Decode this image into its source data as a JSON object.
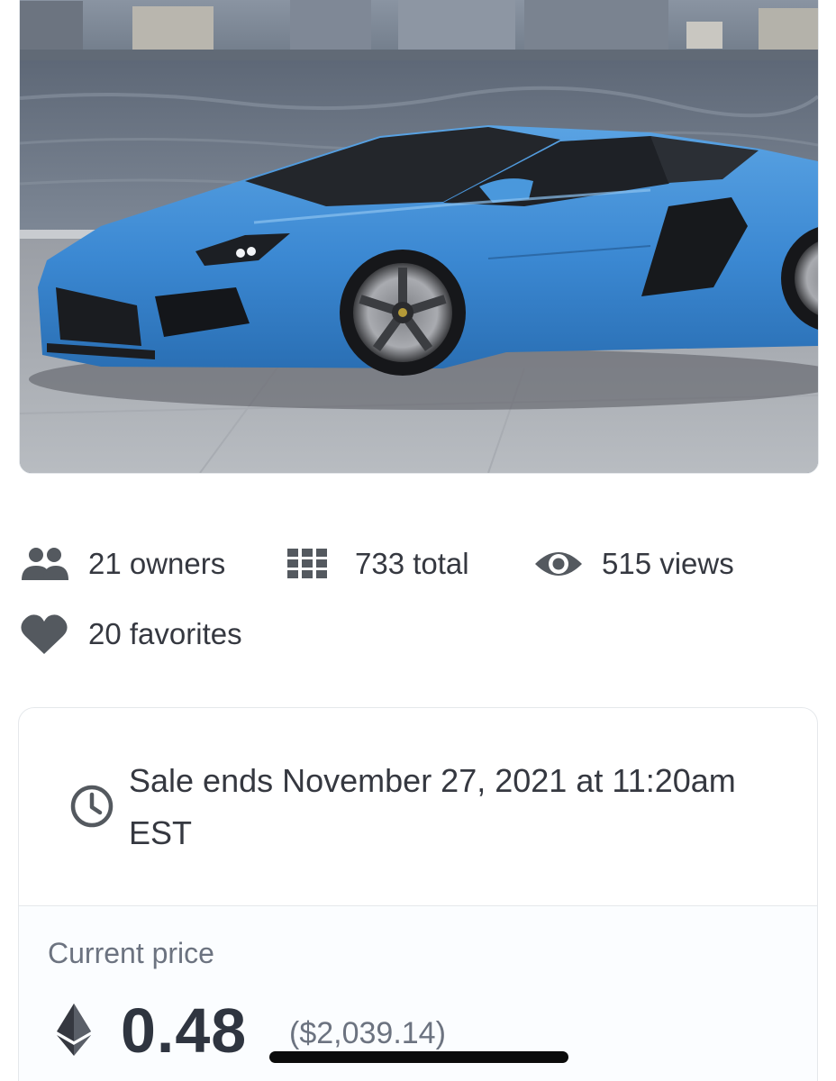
{
  "stats": {
    "owners": "21 owners",
    "total": "733 total",
    "views": "515 views",
    "favorites": "20 favorites"
  },
  "icons": {
    "owners": "people-icon",
    "total": "grid-icon",
    "views": "eye-icon",
    "favorites": "heart-icon",
    "sale": "clock-icon",
    "currency": "ethereum-icon"
  },
  "sale": {
    "ends_text": "Sale ends November 27, 2021 at 11:20am EST"
  },
  "price": {
    "label": "Current price",
    "value": "0.48",
    "usd": "($2,039.14)"
  },
  "colors": {
    "icon": "#54595f",
    "text": "#353840",
    "muted": "#6c7380",
    "border": "#e5e8eb",
    "car_blue": "#3d8fd6"
  }
}
